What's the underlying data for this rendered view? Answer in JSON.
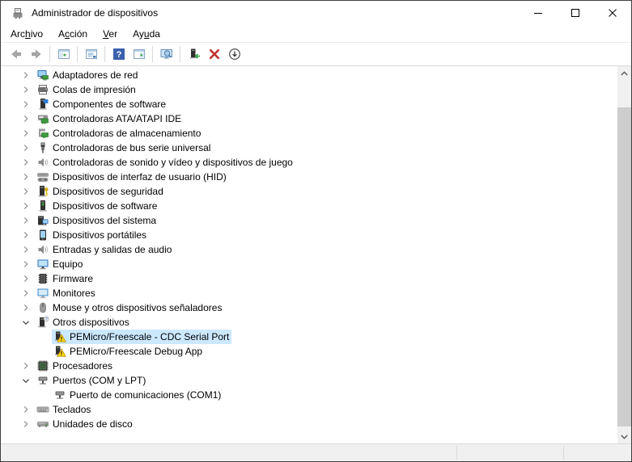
{
  "window": {
    "title": "Administrador de dispositivos",
    "icon": "device-manager-icon",
    "controls": [
      {
        "name": "minimize"
      },
      {
        "name": "maximize"
      },
      {
        "name": "close"
      }
    ]
  },
  "menubar": {
    "items": [
      {
        "label": "Archivo",
        "pre": "Arc",
        "key": "h",
        "post": "ivo"
      },
      {
        "label": "Acción",
        "pre": "A",
        "key": "c",
        "post": "ción"
      },
      {
        "label": "Ver",
        "pre": "",
        "key": "V",
        "post": "er"
      },
      {
        "label": "Ayuda",
        "pre": "Ay",
        "key": "u",
        "post": "da"
      }
    ]
  },
  "toolbar": {
    "groups": [
      {
        "buttons": [
          {
            "name": "back",
            "icon": "back-arrow-icon"
          },
          {
            "name": "forward",
            "icon": "forward-arrow-icon"
          }
        ]
      },
      {
        "buttons": [
          {
            "name": "show-console-tree",
            "icon": "console-tree-window-icon"
          }
        ]
      },
      {
        "buttons": [
          {
            "name": "properties",
            "icon": "properties-window-icon"
          }
        ]
      },
      {
        "buttons": [
          {
            "name": "help",
            "icon": "help-icon"
          },
          {
            "name": "action-pane",
            "icon": "action-pane-window-icon"
          }
        ]
      },
      {
        "buttons": [
          {
            "name": "scan-hardware-changes",
            "icon": "scan-hardware-icon"
          }
        ]
      },
      {
        "buttons": [
          {
            "name": "update-driver",
            "icon": "update-driver-icon"
          },
          {
            "name": "uninstall-device",
            "icon": "uninstall-x-icon"
          },
          {
            "name": "disable-device",
            "icon": "disable-device-icon"
          }
        ]
      }
    ]
  },
  "tree": {
    "items": [
      {
        "label": "Adaptadores de red",
        "icon": "network-adapter-icon",
        "level": 0,
        "chevron": "collapsed",
        "selected": false
      },
      {
        "label": "Colas de impresión",
        "icon": "printer-icon",
        "level": 0,
        "chevron": "collapsed",
        "selected": false
      },
      {
        "label": "Componentes de software",
        "icon": "software-component-icon",
        "level": 0,
        "chevron": "collapsed",
        "selected": false
      },
      {
        "label": "Controladoras ATA/ATAPI IDE",
        "icon": "ide-controller-icon",
        "level": 0,
        "chevron": "collapsed",
        "selected": false
      },
      {
        "label": "Controladoras de almacenamiento",
        "icon": "storage-controller-icon",
        "level": 0,
        "chevron": "collapsed",
        "selected": false
      },
      {
        "label": "Controladoras de bus serie universal",
        "icon": "usb-controller-icon",
        "level": 0,
        "chevron": "collapsed",
        "selected": false
      },
      {
        "label": "Controladoras de sonido y vídeo y dispositivos de juego",
        "icon": "speaker-icon",
        "level": 0,
        "chevron": "collapsed",
        "selected": false
      },
      {
        "label": "Dispositivos de interfaz de usuario (HID)",
        "icon": "hid-device-icon",
        "level": 0,
        "chevron": "collapsed",
        "selected": false
      },
      {
        "label": "Dispositivos de seguridad",
        "icon": "security-device-icon",
        "level": 0,
        "chevron": "collapsed",
        "selected": false
      },
      {
        "label": "Dispositivos de software",
        "icon": "software-device-icon",
        "level": 0,
        "chevron": "collapsed",
        "selected": false
      },
      {
        "label": "Dispositivos del sistema",
        "icon": "system-device-icon",
        "level": 0,
        "chevron": "collapsed",
        "selected": false
      },
      {
        "label": "Dispositivos portátiles",
        "icon": "portable-device-icon",
        "level": 0,
        "chevron": "collapsed",
        "selected": false
      },
      {
        "label": "Entradas y salidas de audio",
        "icon": "speaker-icon",
        "level": 0,
        "chevron": "collapsed",
        "selected": false
      },
      {
        "label": "Equipo",
        "icon": "computer-icon",
        "level": 0,
        "chevron": "collapsed",
        "selected": false
      },
      {
        "label": "Firmware",
        "icon": "firmware-chip-icon",
        "level": 0,
        "chevron": "collapsed",
        "selected": false
      },
      {
        "label": "Monitores",
        "icon": "monitor-icon",
        "level": 0,
        "chevron": "collapsed",
        "selected": false
      },
      {
        "label": "Mouse y otros dispositivos señaladores",
        "icon": "mouse-icon",
        "level": 0,
        "chevron": "collapsed",
        "selected": false
      },
      {
        "label": "Otros dispositivos",
        "icon": "other-device-icon",
        "level": 0,
        "chevron": "expanded",
        "selected": false
      },
      {
        "label": "PEMicro/Freescale - CDC Serial Port",
        "icon": "unknown-device-warning-icon",
        "level": 1,
        "chevron": "none",
        "selected": true
      },
      {
        "label": "PEMicro/Freescale Debug App",
        "icon": "unknown-device-warning-icon",
        "level": 1,
        "chevron": "none",
        "selected": false
      },
      {
        "label": "Procesadores",
        "icon": "processor-icon",
        "level": 0,
        "chevron": "collapsed",
        "selected": false
      },
      {
        "label": "Puertos (COM y LPT)",
        "icon": "port-icon",
        "level": 0,
        "chevron": "expanded",
        "selected": false
      },
      {
        "label": "Puerto de comunicaciones (COM1)",
        "icon": "port-icon",
        "level": 1,
        "chevron": "none",
        "selected": false
      },
      {
        "label": "Teclados",
        "icon": "keyboard-icon",
        "level": 0,
        "chevron": "collapsed",
        "selected": false
      },
      {
        "label": "Unidades de disco",
        "icon": "disk-drive-icon",
        "level": 0,
        "chevron": "collapsed",
        "selected": false
      }
    ]
  },
  "statusbar": {
    "text": ""
  },
  "colors": {
    "selection": "#cce8ff",
    "warning_yellow": "#fbd20a",
    "help_blue": "#3a62ad",
    "uninstall_red": "#bf3434",
    "scrollbar_track": "#f0f0f0",
    "scrollbar_thumb": "#cdcdcd"
  }
}
